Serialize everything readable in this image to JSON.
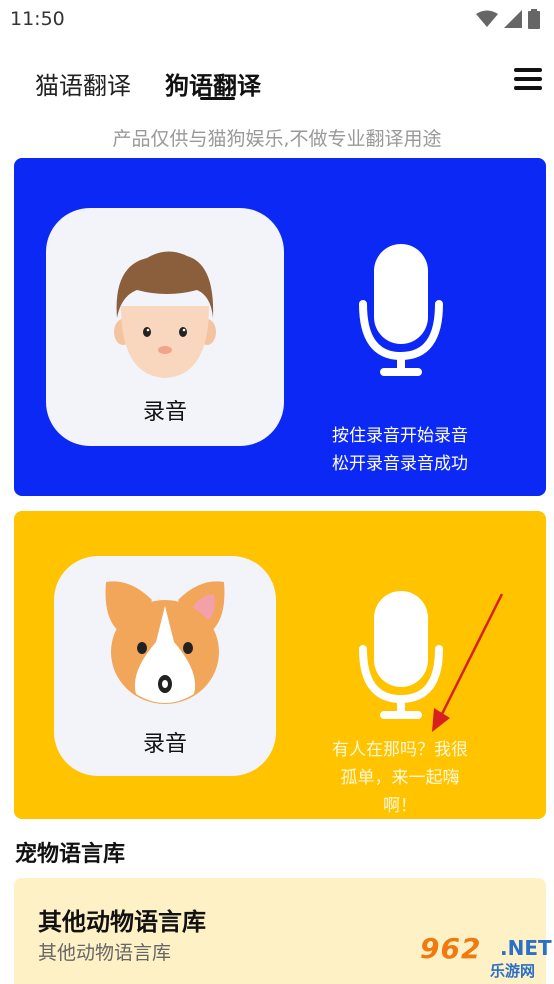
{
  "status_bar": {
    "time": "11:50",
    "icons": [
      "wifi-icon",
      "signal-icon",
      "battery-icon"
    ]
  },
  "tabs": [
    {
      "label": "猫语翻译",
      "active": false
    },
    {
      "label": "狗语翻译",
      "active": true
    }
  ],
  "disclaimer": "产品仅供与猫狗娱乐,不做专业翻译用途",
  "human_card": {
    "color": "#0c28f5",
    "record_label": "录音",
    "caption_line1": "按住录音开始录音",
    "caption_line2": "松开录音录音成功"
  },
  "dog_card": {
    "color": "#ffc300",
    "record_label": "录音",
    "caption_line1": "有人在那吗？我很",
    "caption_line2": "孤单，来一起嗨",
    "caption_line3": "啊！"
  },
  "section": {
    "title": "宠物语言库"
  },
  "library_card": {
    "title": "其他动物语言库",
    "subtitle": "其他动物语言库"
  },
  "watermark": {
    "number": "962",
    "suffix": ".NET",
    "sub": "乐游网"
  }
}
